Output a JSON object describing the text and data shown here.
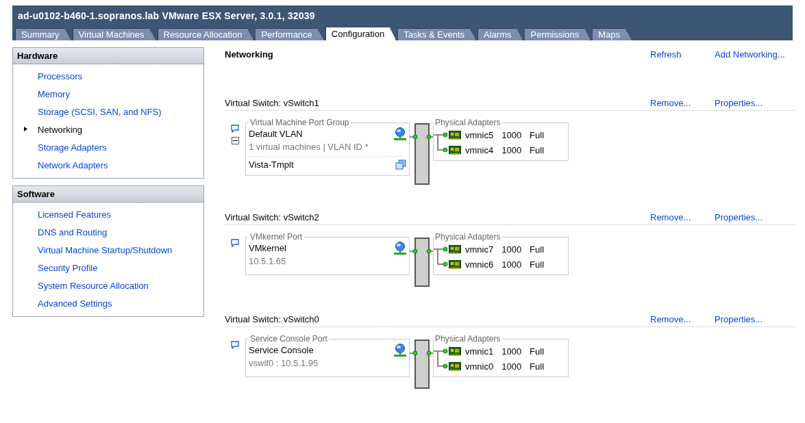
{
  "window": {
    "title": "ad-u0102-b460-1.sopranos.lab  VMware ESX Server, 3.0.1, 32039"
  },
  "tabs": [
    {
      "label": "Summary",
      "selected": false
    },
    {
      "label": "Virtual Machines",
      "selected": false
    },
    {
      "label": "Resource Allocation",
      "selected": false
    },
    {
      "label": "Performance",
      "selected": false
    },
    {
      "label": "Configuration",
      "selected": true
    },
    {
      "label": "Tasks & Events",
      "selected": false
    },
    {
      "label": "Alarms",
      "selected": false
    },
    {
      "label": "Permissions",
      "selected": false
    },
    {
      "label": "Maps",
      "selected": false
    }
  ],
  "sidebar": [
    {
      "title": "Hardware",
      "items": [
        {
          "label": "Processors",
          "selected": false
        },
        {
          "label": "Memory",
          "selected": false
        },
        {
          "label": "Storage (SCSI, SAN, and NFS)",
          "selected": false
        },
        {
          "label": "Networking",
          "selected": true
        },
        {
          "label": "Storage Adapters",
          "selected": false
        },
        {
          "label": "Network Adapters",
          "selected": false
        }
      ]
    },
    {
      "title": "Software",
      "items": [
        {
          "label": "Licensed Features",
          "selected": false
        },
        {
          "label": "DNS and Routing",
          "selected": false
        },
        {
          "label": "Virtual Machine Startup/Shutdown",
          "selected": false
        },
        {
          "label": "Security Profile",
          "selected": false
        },
        {
          "label": "System Resource Allocation",
          "selected": false
        },
        {
          "label": "Advanced Settings",
          "selected": false
        }
      ]
    }
  ],
  "content": {
    "title": "Networking",
    "actions": [
      "Refresh",
      "Add Networking..."
    ],
    "switches": [
      {
        "title": "Virtual Switch: vSwitch1",
        "actions": [
          "Remove...",
          "Properties..."
        ],
        "port_group": {
          "kind": "vm",
          "legend": "Virtual Machine Port Group",
          "name": "Default VLAN",
          "detail": "1 virtual machines | VLAN ID *",
          "expanded": true,
          "vms": [
            "Vista-Tmplt"
          ]
        },
        "adapters_legend": "Physical Adapters",
        "adapters": [
          {
            "name": "vmnic5",
            "speed": "1000",
            "duplex": "Full"
          },
          {
            "name": "vmnic4",
            "speed": "1000",
            "duplex": "Full"
          }
        ]
      },
      {
        "title": "Virtual Switch: vSwitch2",
        "actions": [
          "Remove...",
          "Properties..."
        ],
        "port_group": {
          "kind": "vmkernel",
          "legend": "VMkernel Port",
          "name": "VMkernel",
          "detail": "10.5.1.65"
        },
        "adapters_legend": "Physical Adapters",
        "adapters": [
          {
            "name": "vmnic7",
            "speed": "1000",
            "duplex": "Full"
          },
          {
            "name": "vmnic6",
            "speed": "1000",
            "duplex": "Full"
          }
        ]
      },
      {
        "title": "Virtual Switch: vSwitch0",
        "actions": [
          "Remove...",
          "Properties..."
        ],
        "port_group": {
          "kind": "console",
          "legend": "Service Console Port",
          "name": "Service Console",
          "detail": "vswif0 : 10.5.1.95"
        },
        "adapters_legend": "Physical Adapters",
        "adapters": [
          {
            "name": "vmnic1",
            "speed": "1000",
            "duplex": "Full"
          },
          {
            "name": "vmnic0",
            "speed": "1000",
            "duplex": "Full"
          }
        ]
      }
    ]
  }
}
